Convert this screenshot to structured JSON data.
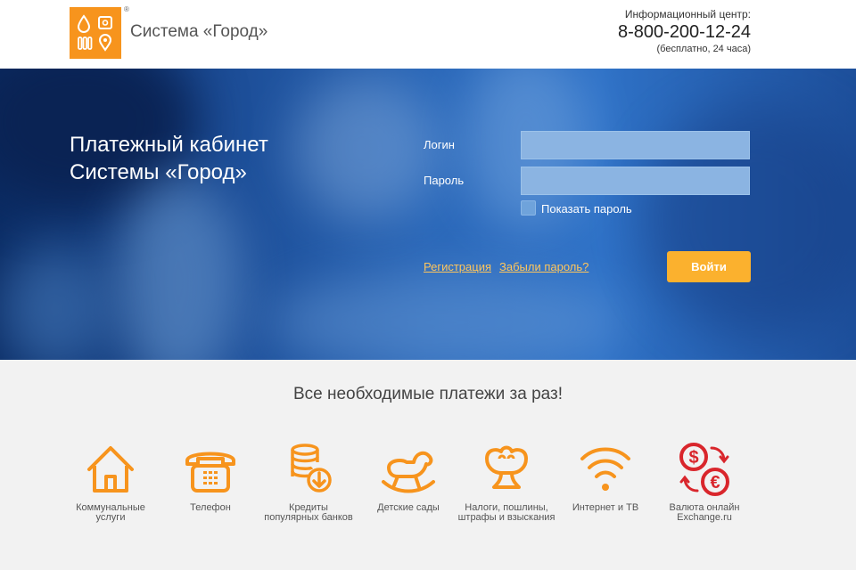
{
  "header": {
    "brand": "Система «Город»",
    "registered_mark": "®",
    "info_label": "Информационный центр:",
    "phone": "8-800-200-12-24",
    "phone_note": "(бесплатно, 24 часа)",
    "logo_color": "#f7941d"
  },
  "hero": {
    "title_line1": "Платежный кабинет",
    "title_line2": "Системы «Город»",
    "login_label": "Логин",
    "password_label": "Пароль",
    "login_value": "",
    "password_value": "",
    "show_password_label": "Показать пароль",
    "register_link": "Регистрация",
    "forgot_link": "Забыли пароль?",
    "login_button": "Войти",
    "accent": "#fbb12e"
  },
  "payments": {
    "tagline": "Все необходимые платежи за раз!",
    "icon_color": "#f7941d",
    "currency_color": "#d9262c",
    "categories": [
      {
        "icon": "house-icon",
        "line1": "Коммунальные",
        "line2": "услуги"
      },
      {
        "icon": "telephone-icon",
        "line1": "Телефон",
        "line2": ""
      },
      {
        "icon": "coins-icon",
        "line1": "Кредиты",
        "line2": "популярных банков"
      },
      {
        "icon": "rocking-horse-icon",
        "line1": "Детские сады",
        "line2": ""
      },
      {
        "icon": "emblem-icon",
        "line1": "Налоги, пошлины,",
        "line2": "штрафы и взыскания"
      },
      {
        "icon": "wifi-icon",
        "line1": "Интернет и ТВ",
        "line2": ""
      },
      {
        "icon": "currency-exchange-icon",
        "line1": "Валюта онлайн",
        "line2": "Exchange.ru"
      }
    ]
  }
}
